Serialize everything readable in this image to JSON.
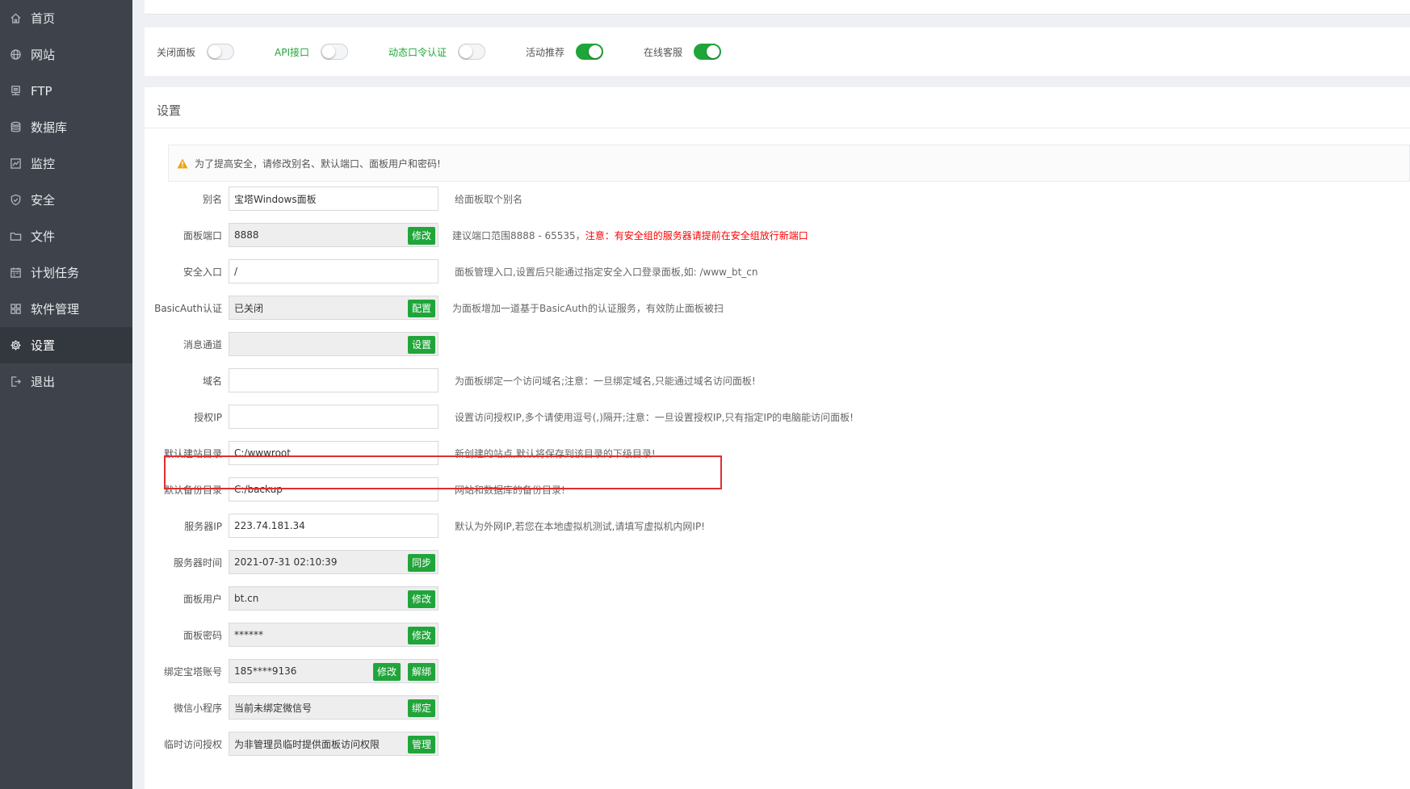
{
  "sidebar": {
    "items": [
      {
        "label": "首页",
        "icon": "home-icon"
      },
      {
        "label": "网站",
        "icon": "globe-icon"
      },
      {
        "label": "FTP",
        "icon": "ftp-icon"
      },
      {
        "label": "数据库",
        "icon": "database-icon"
      },
      {
        "label": "监控",
        "icon": "monitor-icon"
      },
      {
        "label": "安全",
        "icon": "shield-icon"
      },
      {
        "label": "文件",
        "icon": "folder-icon"
      },
      {
        "label": "计划任务",
        "icon": "calendar-icon"
      },
      {
        "label": "软件管理",
        "icon": "grid-icon"
      },
      {
        "label": "设置",
        "icon": "gear-icon",
        "active": true
      },
      {
        "label": "退出",
        "icon": "logout-icon"
      }
    ]
  },
  "toggles": [
    {
      "label": "关闭面板",
      "state": "off",
      "label_color": "default"
    },
    {
      "label": "API接口",
      "state": "off",
      "label_color": "green"
    },
    {
      "label": "动态口令认证",
      "state": "off",
      "label_color": "green"
    },
    {
      "label": "活动推荐",
      "state": "on",
      "label_color": "default"
    },
    {
      "label": "在线客服",
      "state": "on",
      "label_color": "default"
    }
  ],
  "settings": {
    "title": "设置",
    "warning": "为了提高安全，请修改别名、默认端口、面板用户和密码!",
    "rows": [
      {
        "label": "别名",
        "value": "宝塔Windows面板",
        "readonly": false,
        "hint": "给面板取个别名"
      },
      {
        "label": "面板端口",
        "value": "8888",
        "readonly": true,
        "button": "修改",
        "hint": "建议端口范围8888 - 65535，",
        "hint_red": "注意：有安全组的服务器请提前在安全组放行新端口"
      },
      {
        "label": "安全入口",
        "value": "/",
        "readonly": false,
        "hint": "面板管理入口,设置后只能通过指定安全入口登录面板,如: /www_bt_cn"
      },
      {
        "label": "BasicAuth认证",
        "value": "已关闭",
        "readonly": true,
        "button": "配置",
        "hint": "为面板增加一道基于BasicAuth的认证服务，有效防止面板被扫"
      },
      {
        "label": "消息通道",
        "value": "",
        "readonly": true,
        "button": "设置",
        "hint": ""
      },
      {
        "label": "域名",
        "value": "",
        "readonly": false,
        "hint": "为面板绑定一个访问域名;注意：一旦绑定域名,只能通过域名访问面板!"
      },
      {
        "label": "授权IP",
        "value": "",
        "readonly": false,
        "hint": "设置访问授权IP,多个请使用逗号(,)隔开;注意：一旦设置授权IP,只有指定IP的电脑能访问面板!"
      },
      {
        "label": "默认建站目录",
        "value": "C:/wwwroot",
        "readonly": false,
        "hint": "新创建的站点,默认将保存到该目录的下级目录!"
      },
      {
        "label": "默认备份目录",
        "value": "C:/backup",
        "readonly": false,
        "hint": "网站和数据库的备份目录!"
      },
      {
        "label": "服务器IP",
        "value": "223.74.181.34",
        "readonly": false,
        "hint": "默认为外网IP,若您在本地虚拟机测试,请填写虚拟机内网IP!"
      },
      {
        "label": "服务器时间",
        "value": "2021-07-31 02:10:39",
        "readonly": true,
        "button": "同步",
        "hint": ""
      },
      {
        "label": "面板用户",
        "value": "bt.cn",
        "readonly": true,
        "button": "修改",
        "hint": ""
      },
      {
        "label": "面板密码",
        "value": "******",
        "readonly": true,
        "button": "修改",
        "hint": ""
      },
      {
        "label": "绑定宝塔账号",
        "value": "185****9136",
        "readonly": true,
        "button": "修改",
        "button2": "解绑",
        "hint": ""
      },
      {
        "label": "微信小程序",
        "value": "当前未绑定微信号",
        "readonly": true,
        "button": "绑定",
        "hint": ""
      },
      {
        "label": "临时访问授权",
        "value": "为非管理员临时提供面板访问权限",
        "readonly": true,
        "button": "管理",
        "hint": ""
      }
    ]
  },
  "colors": {
    "sidebar_bg": "#3e434b",
    "accent": "#20a53a",
    "highlight": "#e02e2e",
    "warn": "#ff0000"
  }
}
